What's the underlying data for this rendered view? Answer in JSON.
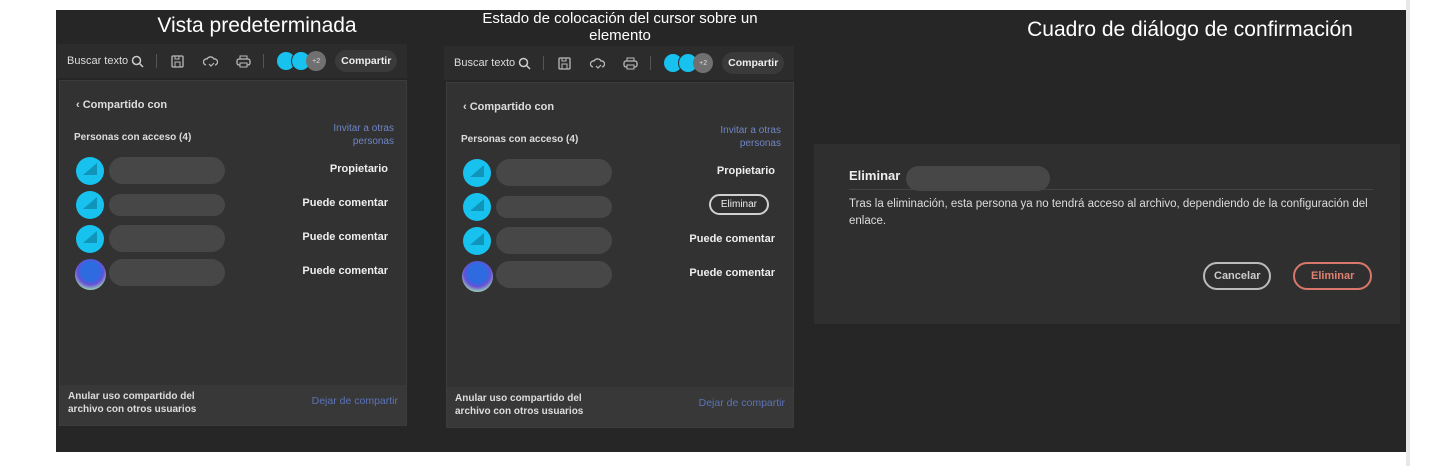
{
  "titles": {
    "default_view": "Vista predeterminada",
    "hover_state": "Estado de colocación del cursor sobre un elemento",
    "confirm_dialog": "Cuadro de diálogo de confirmación"
  },
  "toolbar": {
    "search_label": "Buscar texto",
    "more_count": "+2",
    "share_label": "Compartir"
  },
  "panel": {
    "back_label": "Compartido con",
    "access_label": "Personas con acceso (4)",
    "invite_label": "Invitar a otras personas",
    "footer_text": "Anular uso compartido del archivo con otros usuarios",
    "footer_link": "Dejar de compartir"
  },
  "people": [
    {
      "role": "Propietario"
    },
    {
      "role": "Puede comentar"
    },
    {
      "role": "Puede comentar"
    },
    {
      "role": "Puede comentar"
    }
  ],
  "hover": {
    "remove_label": "Eliminar"
  },
  "dialog": {
    "title": "Eliminar",
    "message": "Tras la eliminación, esta persona ya no tendrá acceso al archivo, dependiendo de la configuración del enlace.",
    "cancel_label": "Cancelar",
    "confirm_label": "Eliminar"
  }
}
